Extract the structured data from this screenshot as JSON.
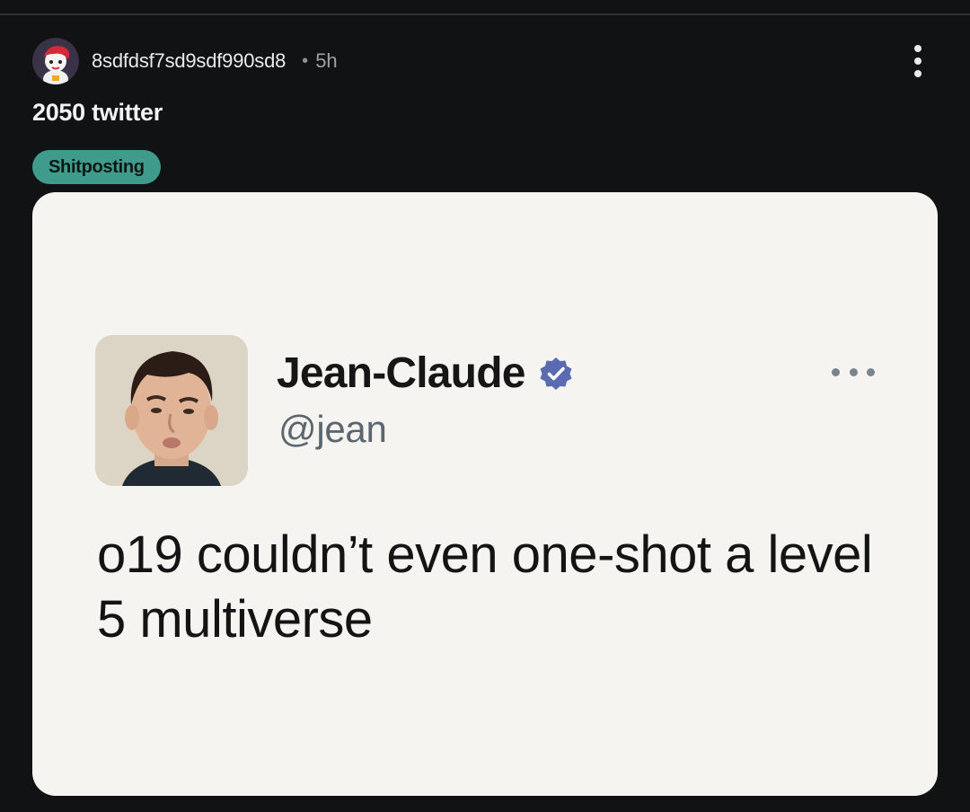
{
  "post": {
    "author": "8sdfdsf7sd9sdf990sd8",
    "separator": "•",
    "age": "5h",
    "title": "2050 twitter",
    "flair": "Shitposting",
    "menu_icon": "vertical-ellipsis-icon"
  },
  "tweet": {
    "name": "Jean-Claude",
    "handle": "@jean",
    "text": "o19 couldn’t even one-shot a level 5 multiverse",
    "verified": true,
    "verified_color": "#5b6bb1",
    "menu_icon": "horizontal-ellipsis-icon"
  },
  "colors": {
    "background": "#111214",
    "flair": "#3f9b8c",
    "card": "#f5f4f1"
  }
}
